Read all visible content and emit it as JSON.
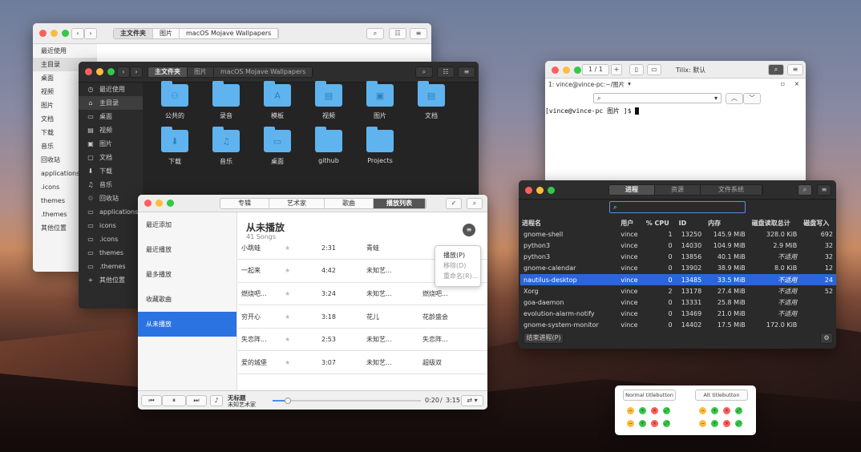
{
  "finder_back": {
    "breadcrumb": [
      "主文件夹",
      "图片",
      "macOS Mojave Wallpapers"
    ],
    "sidebar": [
      "最近使用",
      "主目录",
      "桌面",
      "视频",
      "图片",
      "文档",
      "下载",
      "音乐",
      "回收站",
      "applications",
      ".icons",
      "themes",
      ".themes",
      "其他位置"
    ]
  },
  "finder_front": {
    "breadcrumb": [
      "主文件夹",
      "图片",
      "macOS Mojave Wallpapers"
    ],
    "sidebar": [
      {
        "icon": "◷",
        "label": "最近使用"
      },
      {
        "icon": "⌂",
        "label": "主目录"
      },
      {
        "icon": "▭",
        "label": "桌面"
      },
      {
        "icon": "▤",
        "label": "视频"
      },
      {
        "icon": "▣",
        "label": "图片"
      },
      {
        "icon": "▢",
        "label": "文档"
      },
      {
        "icon": "⬇",
        "label": "下载"
      },
      {
        "icon": "♫",
        "label": "音乐"
      },
      {
        "icon": "♲",
        "label": "回收站"
      },
      {
        "icon": "▭",
        "label": "applications"
      },
      {
        "icon": "▭",
        "label": "icons"
      },
      {
        "icon": "▭",
        "label": ".icons"
      },
      {
        "icon": "▭",
        "label": "themes"
      },
      {
        "icon": "▭",
        "label": ".themes"
      },
      {
        "icon": "+",
        "label": "其他位置"
      }
    ],
    "folders": [
      {
        "icon": "⚇",
        "label": "公共的"
      },
      {
        "icon": "",
        "label": "录音"
      },
      {
        "icon": "A",
        "label": "模板"
      },
      {
        "icon": "▤",
        "label": "视频"
      },
      {
        "icon": "▣",
        "label": "图片"
      },
      {
        "icon": "▤",
        "label": "文档"
      },
      {
        "icon": "⬇",
        "label": "下载"
      },
      {
        "icon": "♫",
        "label": "音乐"
      },
      {
        "icon": "▭",
        "label": "桌面"
      },
      {
        "icon": "",
        "label": "github"
      },
      {
        "icon": "",
        "label": "Projects"
      }
    ]
  },
  "terminal": {
    "tab": "1 / 1",
    "title": "Tilix: 默认",
    "session": "1: vince@vince-pc:~/图片",
    "prompt": "[vince@vince-pc 图片 ]$ "
  },
  "sysmon": {
    "tabs": [
      "进程",
      "资源",
      "文件系统"
    ],
    "columns": [
      "进程名",
      "用户",
      "% CPU",
      "ID",
      "内存",
      "磁盘读取总计",
      "磁盘写入"
    ],
    "rows": [
      [
        "gnome-shell",
        "vince",
        "1",
        "13250",
        "145.9 MiB",
        "328.0 KiB",
        "692"
      ],
      [
        "python3",
        "vince",
        "0",
        "14030",
        "104.9 MiB",
        "2.9 MiB",
        "32"
      ],
      [
        "python3",
        "vince",
        "0",
        "13856",
        "40.1 MiB",
        "不适用",
        "32"
      ],
      [
        "gnome-calendar",
        "vince",
        "0",
        "13902",
        "38.9 MiB",
        "8.0 KiB",
        "12"
      ],
      [
        "nautilus-desktop",
        "vince",
        "0",
        "13485",
        "33.5 MiB",
        "不适用",
        "24"
      ],
      [
        "Xorg",
        "vince",
        "2",
        "13178",
        "27.4 MiB",
        "不适用",
        "52"
      ],
      [
        "goa-daemon",
        "vince",
        "0",
        "13331",
        "25.8 MiB",
        "不适用",
        ""
      ],
      [
        "evolution-alarm-notify",
        "vince",
        "0",
        "13469",
        "21.0 MiB",
        "不适用",
        ""
      ],
      [
        "gnome-system-monitor",
        "vince",
        "0",
        "14402",
        "17.5 MiB",
        "172.0 KiB",
        ""
      ]
    ],
    "end_button": "结束进程(P)"
  },
  "music": {
    "tabs": [
      "专辑",
      "艺术家",
      "歌曲",
      "播放列表"
    ],
    "sidebar": [
      "最近添加",
      "最近播放",
      "最多播放",
      "收藏歌曲",
      "从未播放"
    ],
    "playlist_title": "从未播放",
    "count": "41 Songs",
    "songs": [
      [
        "小跳蛙",
        "2:31",
        "青蛙",
        ""
      ],
      [
        "一起来",
        "4:42",
        "未知艺...",
        ""
      ],
      [
        "燃烧吧...",
        "3:24",
        "未知艺...",
        "燃烧吧..."
      ],
      [
        "穷开心",
        "3:18",
        "花儿",
        "花龄盛会"
      ],
      [
        "失恋阵...",
        "2:53",
        "未知艺...",
        "失恋阵..."
      ],
      [
        "爱的城堡",
        "3:07",
        "未知艺...",
        "超级双"
      ]
    ],
    "menu": [
      "播放(P)",
      "移除(D)",
      "重命名(R)..."
    ],
    "now_title": "无标题",
    "now_artist": "未知艺术家",
    "time": "0:20",
    "duration": "3:15",
    "progress": 0.1
  },
  "titlebuttons": {
    "normal": "Normal titlebutton",
    "alt": "Alt titlebutton"
  }
}
